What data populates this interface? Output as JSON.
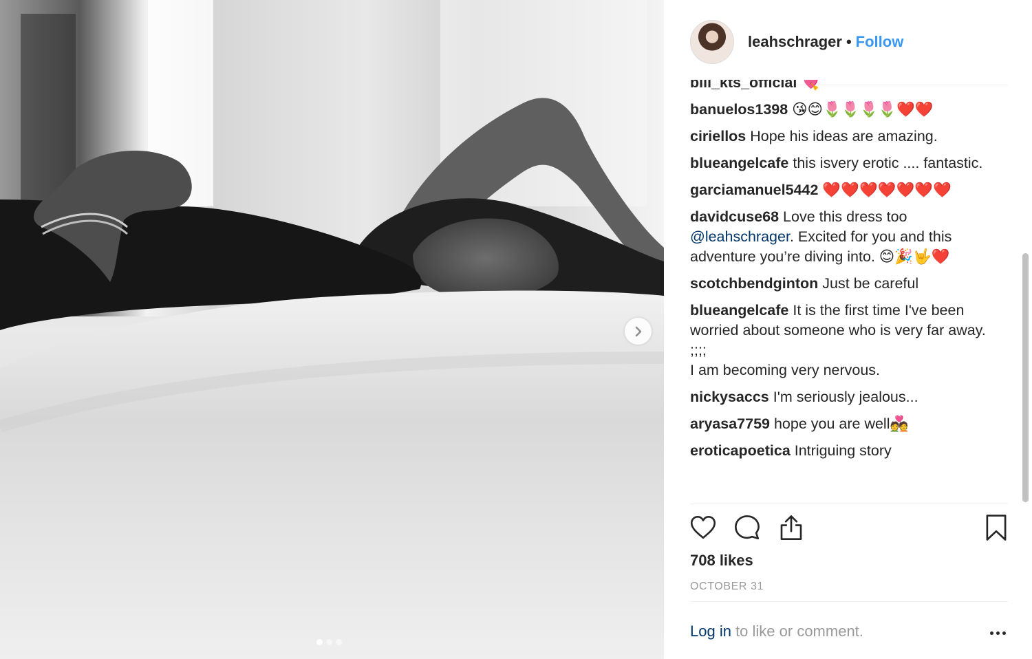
{
  "post": {
    "author": "leahschrager",
    "separator": "•",
    "follow_label": "Follow",
    "likes": "708 likes",
    "date": "OCTOBER 31",
    "login_link": "Log in",
    "login_suffix": " to like or comment."
  },
  "carousel": {
    "slide_count": 3,
    "active_index": 0
  },
  "comments": [
    {
      "user": "bill_kts_official",
      "text": " 💘"
    },
    {
      "user": "banuelos1398",
      "text": " 😘😊🌷🌷🌷🌷❤️❤️"
    },
    {
      "user": "ciriellos",
      "text": " Hope his ideas are amazing."
    },
    {
      "user": "blueangelcafe",
      "text": " this isvery erotic .... fantastic."
    },
    {
      "user": "garciamanuel5442",
      "text": " ❤️❤️❤️❤️❤️❤️❤️"
    },
    {
      "user": "davidcuse68",
      "text_before": " Love this dress too ",
      "mention": "@leahschrager",
      "text_after": ". Excited for you and this adventure you’re diving into. 😊🎉🤟❤️"
    },
    {
      "user": "scotchbendginton",
      "text": " Just be careful"
    },
    {
      "user": "blueangelcafe",
      "text": " It is the first time I've been worried about someone who is very far away.",
      "extra_lines": [
        ";;;;",
        "I am becoming very nervous."
      ]
    },
    {
      "user": "nickysaccs",
      "text": " I'm seriously jealous..."
    },
    {
      "user": "aryasa7759",
      "text": " hope you are well💑"
    },
    {
      "user": "eroticapoetica",
      "text": " Intriguing story"
    }
  ],
  "icons": {
    "like": "heart-icon",
    "comment": "comment-bubble-icon",
    "share": "share-icon",
    "save": "bookmark-icon",
    "next": "chevron-right-icon",
    "more": "more-dots-icon"
  },
  "colors": {
    "link_blue": "#3897f0",
    "mention_blue": "#003569",
    "text": "#262626",
    "muted": "#999999"
  }
}
